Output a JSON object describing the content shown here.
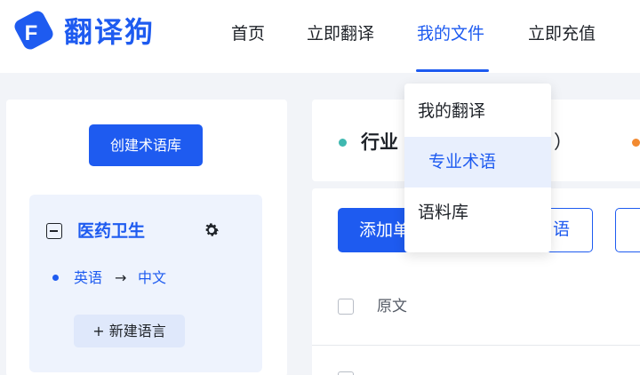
{
  "brand": {
    "name": "翻译狗",
    "logo_letter": "F",
    "logo_icon": "f-logo-icon"
  },
  "nav": {
    "items": [
      {
        "label": "首页"
      },
      {
        "label": "立即翻译"
      },
      {
        "label": "我的文件",
        "active": true
      },
      {
        "label": "立即充值"
      }
    ]
  },
  "dropdown": {
    "items": [
      {
        "label": "我的翻译"
      },
      {
        "label": "专业术语",
        "active": true
      },
      {
        "label": "语料库"
      }
    ]
  },
  "sidebar": {
    "create_button": "创建术语库",
    "glossary": {
      "name": "医药卫生",
      "collapse_icon": "minus-square-icon",
      "settings_icon": "gear-icon",
      "language_pair": {
        "source": "英语",
        "arrow": "→",
        "target": "中文"
      },
      "new_language_button": "+ 新建语言"
    }
  },
  "main": {
    "header": {
      "industry_label": "行业",
      "paren_text": "）"
    },
    "toolbar": {
      "add_button": "添加单",
      "outline_button_text": "语"
    },
    "table": {
      "columns": [
        "原文"
      ]
    }
  },
  "colors": {
    "accent": "#1e5bf0",
    "teal_dot": "#3fb8b0",
    "orange_dot": "#f28a30",
    "background": "#f2f4f8"
  }
}
